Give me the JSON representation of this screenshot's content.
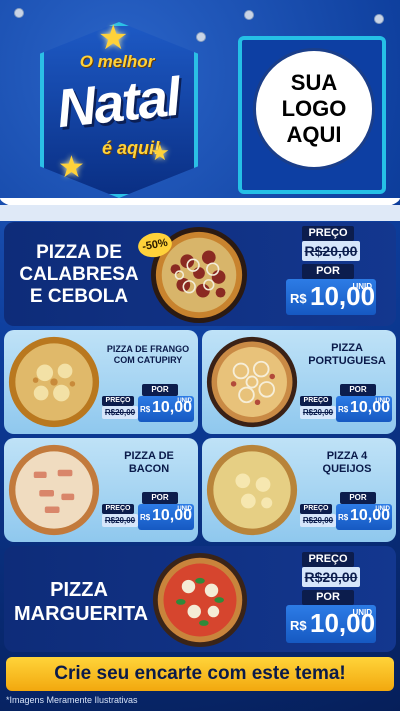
{
  "header": {
    "title_top": "O melhor",
    "title_main": "Natal",
    "title_bottom": "é aqui!",
    "logo_lines": [
      "SUA",
      "LOGO",
      "AQUI"
    ]
  },
  "featured_1": {
    "name_lines": [
      "PIZZA DE",
      "CALABRESA",
      "E CEBOLA"
    ],
    "discount": "-50%",
    "preco_label": "PREÇO",
    "old_price": "R$20,00",
    "por_label": "POR",
    "currency": "R$",
    "new_price": "10,00",
    "unit": "UNID"
  },
  "grid": [
    {
      "name_lines": [
        "PIZZA DE FRANGO",
        "COM CATUPIRY"
      ],
      "preco_label": "PREÇO",
      "old_price": "R$20,00",
      "por_label": "POR",
      "currency": "R$",
      "new_price": "10,00",
      "unit": "UNID"
    },
    {
      "name_lines": [
        "PIZZA",
        "PORTUGUESA"
      ],
      "preco_label": "PREÇO",
      "old_price": "R$20,00",
      "por_label": "POR",
      "currency": "R$",
      "new_price": "10,00",
      "unit": "UNID"
    },
    {
      "name_lines": [
        "PIZZA DE",
        "BACON"
      ],
      "preco_label": "PREÇO",
      "old_price": "R$20,00",
      "por_label": "POR",
      "currency": "R$",
      "new_price": "10,00",
      "unit": "UNID"
    },
    {
      "name_lines": [
        "PIZZA 4",
        "QUEIJOS"
      ],
      "preco_label": "PREÇO",
      "old_price": "R$20,00",
      "por_label": "POR",
      "currency": "R$",
      "new_price": "10,00",
      "unit": "UNID"
    }
  ],
  "featured_2": {
    "name_lines": [
      "PIZZA",
      "MARGUERITA"
    ],
    "preco_label": "PREÇO",
    "old_price": "R$20,00",
    "por_label": "POR",
    "currency": "R$",
    "new_price": "10,00",
    "unit": "UNID"
  },
  "cta": "Crie seu encarte com este tema!",
  "disclaimer": "*Imagens Meramente Ilustrativas",
  "colors": {
    "background": "#0a3a8c",
    "accent_yellow": "#ffd23a",
    "price_blue": "#1f6bd6",
    "card_light": "#a9d6f3",
    "card_dark": "#0e2c79"
  }
}
